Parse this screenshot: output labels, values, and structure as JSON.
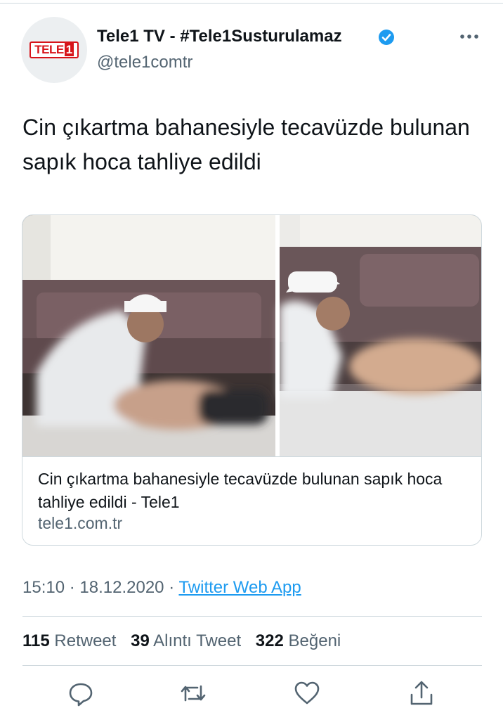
{
  "author": {
    "avatar_logo_text": "TELE1",
    "display_name": "Tele1 TV - #Tele1Susturulamaz",
    "handle": "@tele1comtr",
    "verified_icon": "verified-badge-icon",
    "more_icon": "more-options-icon"
  },
  "tweet": {
    "text": "Cin çıkartma bahanesiyle tecavüzde bulunan sapık hoca tahliye edildi"
  },
  "link_card": {
    "title": "Cin çıkartma bahanesiyle tecavüzde bulunan sapık hoca tahliye edildi - Tele1",
    "domain": "tele1.com.tr"
  },
  "meta": {
    "time": "15:10",
    "separator": "·",
    "date": "18.12.2020",
    "source": "Twitter Web App"
  },
  "stats": {
    "retweets_count": "115",
    "retweets_label": "Retweet",
    "quotes_count": "39",
    "quotes_label": "Alıntı Tweet",
    "likes_count": "322",
    "likes_label": "Beğeni"
  },
  "actions": [
    "reply-icon",
    "retweet-icon",
    "like-icon",
    "share-icon"
  ],
  "colors": {
    "link_blue": "#1d9bf0",
    "secondary_text": "#536471",
    "brand_red": "#d7141a"
  }
}
